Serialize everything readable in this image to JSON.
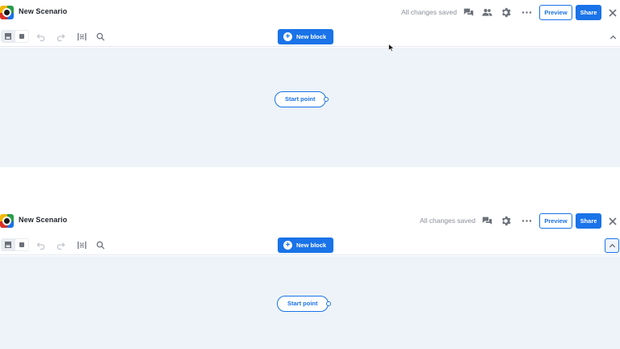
{
  "frames": [
    {
      "header": {
        "title": "New Scenario",
        "status": "All changes saved",
        "preview_label": "Preview",
        "share_label": "Share"
      },
      "toolbar": {
        "new_block_label": "New block"
      },
      "canvas": {
        "start_label": "Start point"
      }
    },
    {
      "header": {
        "title": "New Scenario",
        "status": "All changes saved",
        "preview_label": "Preview",
        "share_label": "Share"
      },
      "toolbar": {
        "new_block_label": "New block"
      },
      "canvas": {
        "start_label": "Start point"
      }
    }
  ],
  "icons": {
    "header": [
      "comments-icon",
      "collaborators-icon",
      "gear-icon",
      "more-icon",
      "close-icon"
    ],
    "toolbar": [
      "document-view-icon",
      "canvas-view-icon",
      "undo-icon",
      "redo-icon",
      "fit-to-screen-icon",
      "search-icon",
      "chevron-up-icon"
    ]
  },
  "colors": {
    "accent": "#1a73e8",
    "canvas_bg": "#edf3f8",
    "icon": "#6b7079"
  }
}
